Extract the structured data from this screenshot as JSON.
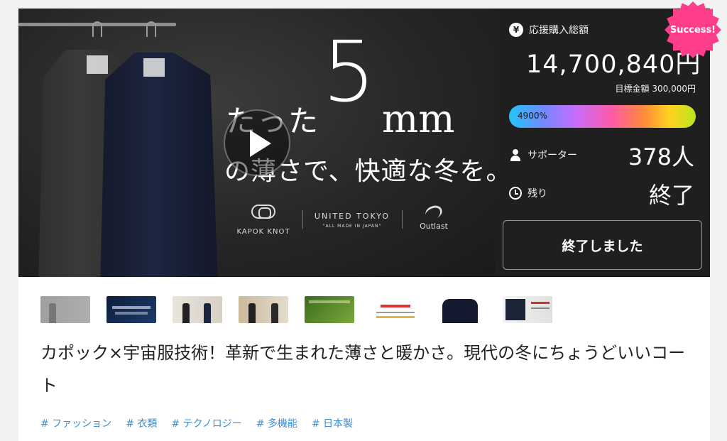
{
  "hero": {
    "line1": "たった",
    "big_number": "5",
    "unit": "mm",
    "line2": "の薄さで、快適な冬を。",
    "logos": {
      "kapok": "KAPOK KNOT",
      "united": "UNITED TOKYO",
      "united_sub": "\"ALL MADE IN JAPAN\"",
      "outlast": "Outlast"
    }
  },
  "stats": {
    "total_label": "応援購入総額",
    "total_amount": "14,700,840円",
    "goal_text": "目標金額 300,000円",
    "progress_label": "4900%",
    "supporters_label": "サポーター",
    "supporters_value": "378人",
    "remaining_label": "残り",
    "remaining_value": "終了",
    "ended_button": "終了しました"
  },
  "badge": "Success!",
  "icons": {
    "yen": "¥",
    "user": "user-icon",
    "clock": "clock-icon"
  },
  "title": "カポック×宇宙服技術！革新で生まれた薄さと暖かさ。現代の冬にちょうどいいコート",
  "tags": [
    "# ファッション",
    "# 衣類",
    "# テクノロジー",
    "# 多機能",
    "# 日本製"
  ]
}
